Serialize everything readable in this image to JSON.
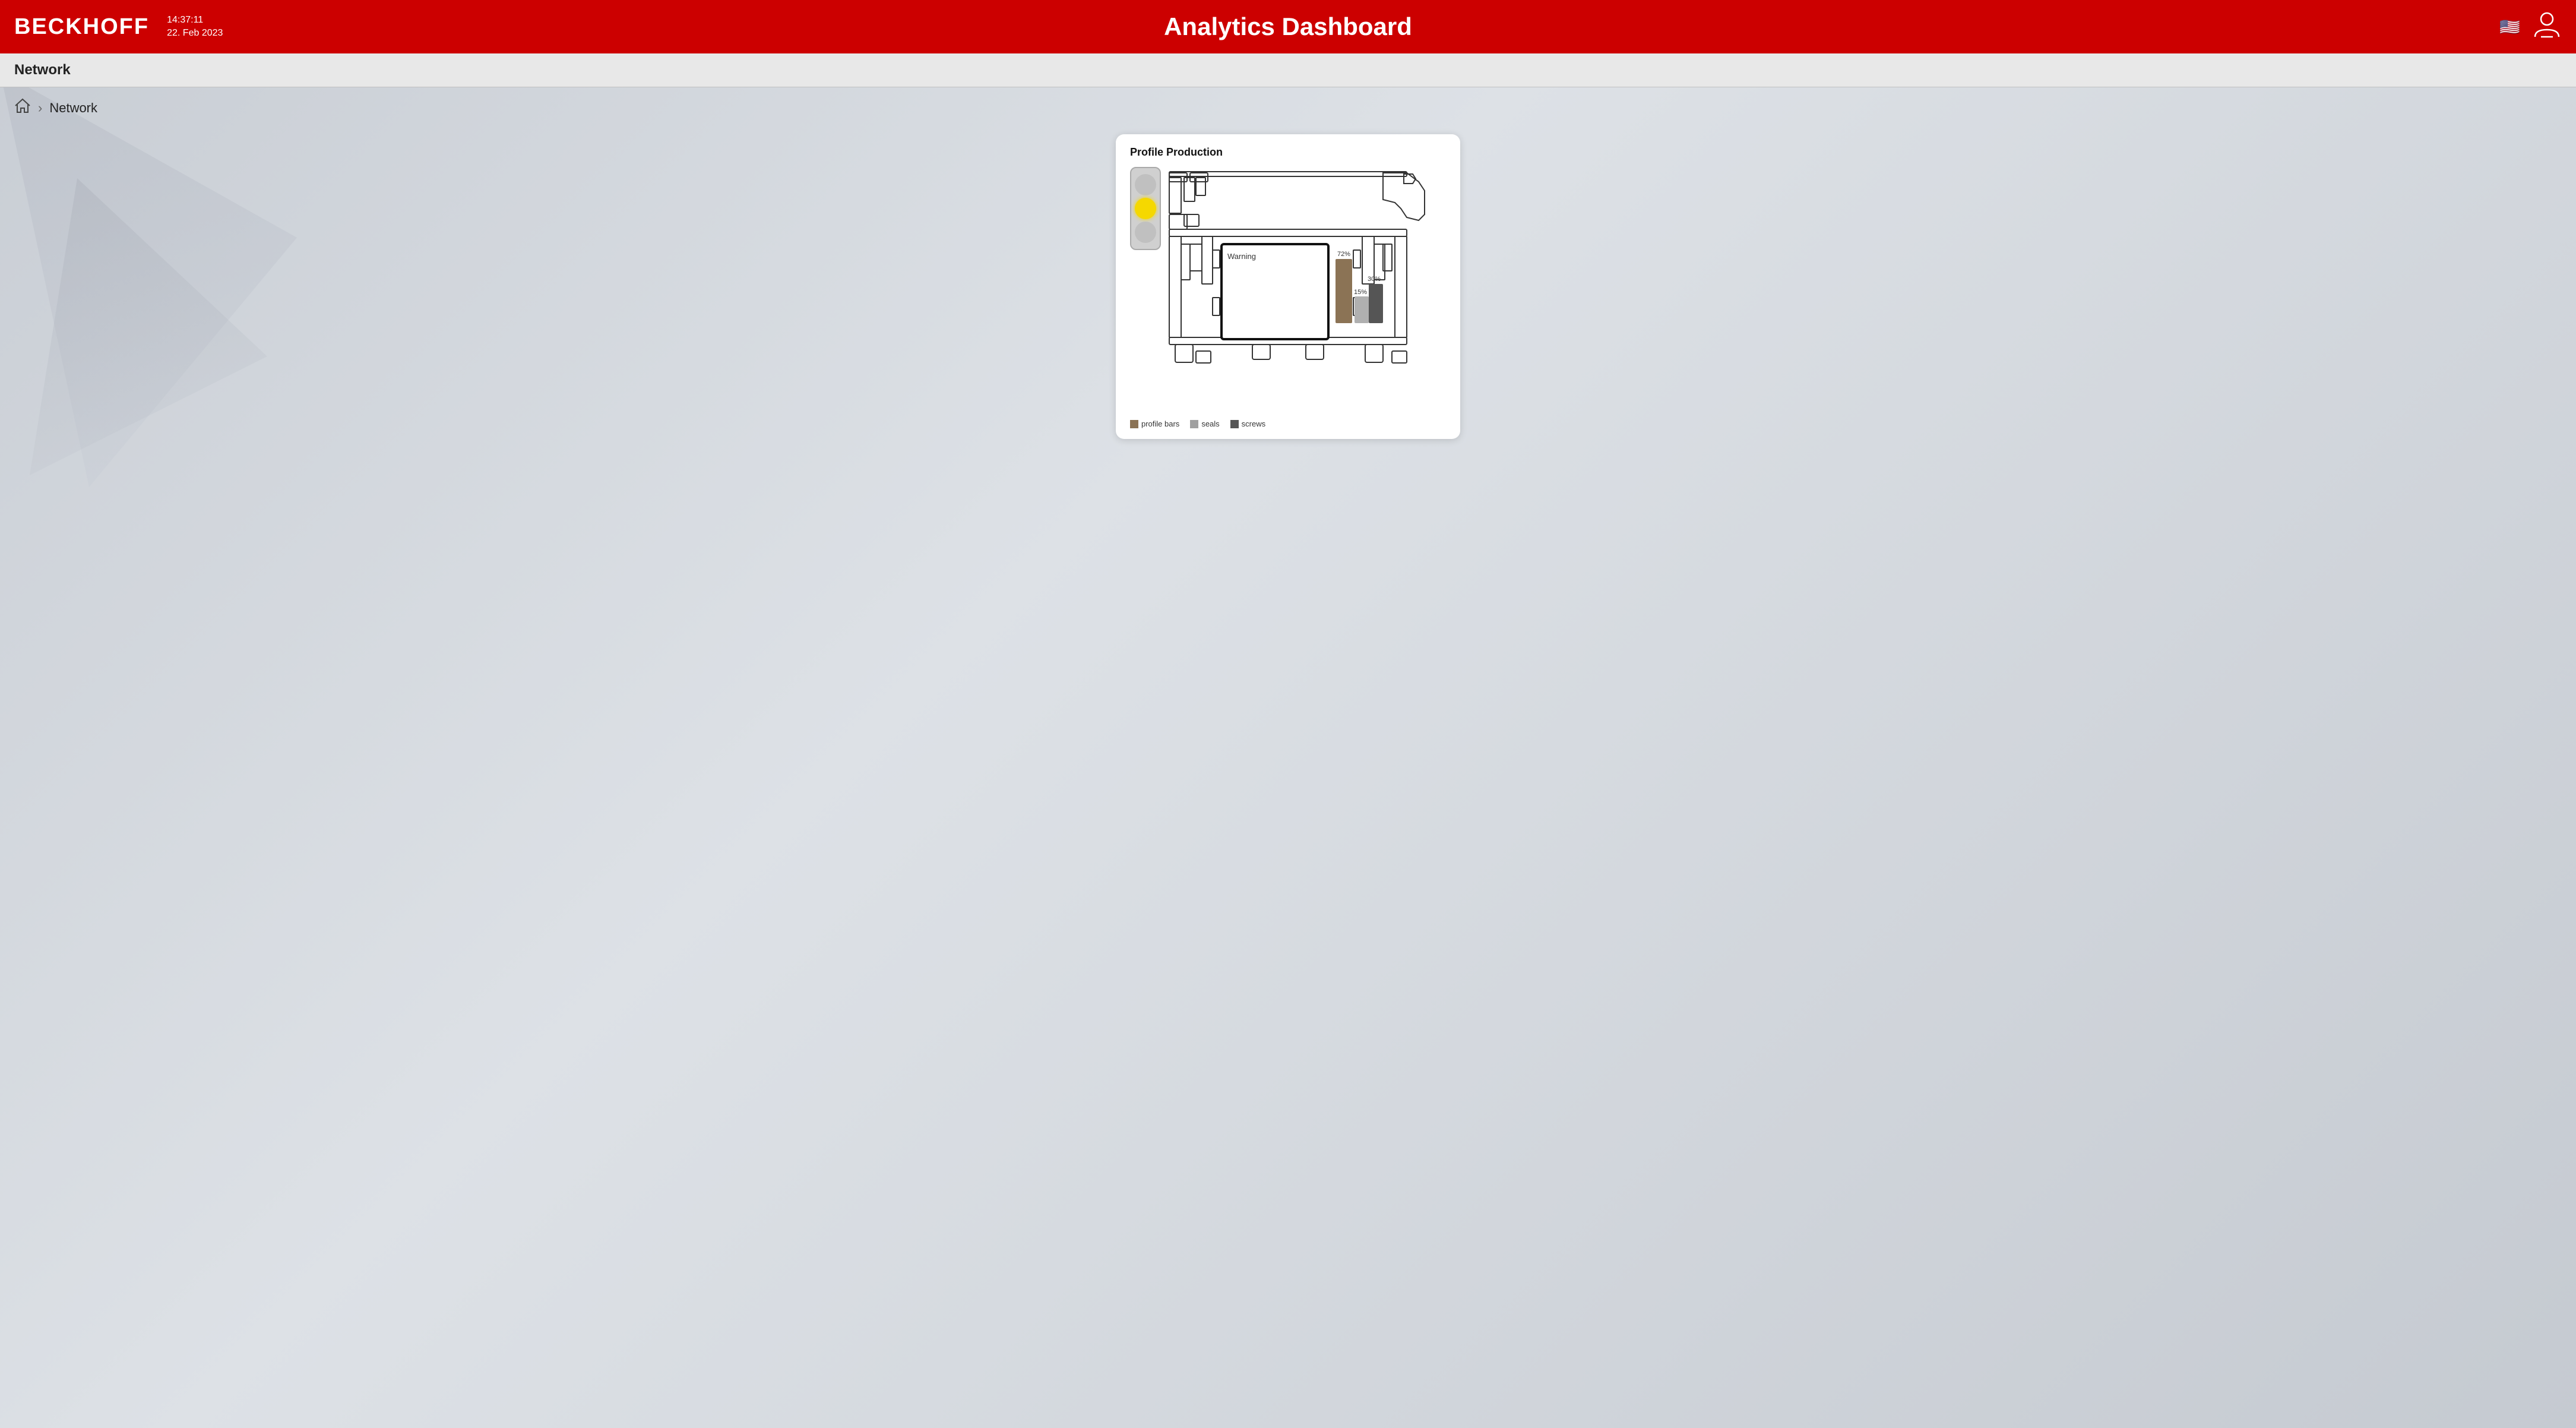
{
  "header": {
    "logo": "BECKHOFF",
    "time": "14:37:11",
    "date": "22. Feb 2023",
    "title": "Analytics Dashboard",
    "flag_alt": "US Flag",
    "user_icon": "👤"
  },
  "subheader": {
    "title": "Network"
  },
  "breadcrumb": {
    "home_icon": "⌂",
    "separator": "›",
    "current": "Network"
  },
  "card": {
    "title": "Profile Production",
    "traffic_light": {
      "red_label": "red",
      "yellow_label": "yellow (active)",
      "green_label": "green"
    },
    "warning_text": "Warning",
    "bars": [
      {
        "id": "profile_bars",
        "value": 72,
        "label": "72%",
        "color": "#8b7355"
      },
      {
        "id": "seals",
        "value": 15,
        "label": "15%",
        "color": "#a0a0a0"
      },
      {
        "id": "screws",
        "value": 30,
        "label": "30%",
        "color": "#555555"
      }
    ],
    "legend": [
      {
        "id": "profile_bars",
        "label": "profile bars",
        "color": "#8b7355",
        "swatch_class": "swatch-brown"
      },
      {
        "id": "seals",
        "label": "seals",
        "color": "#a0a0a0",
        "swatch_class": "swatch-gray"
      },
      {
        "id": "screws",
        "label": "screws",
        "color": "#555555",
        "swatch_class": "swatch-dark"
      }
    ]
  }
}
